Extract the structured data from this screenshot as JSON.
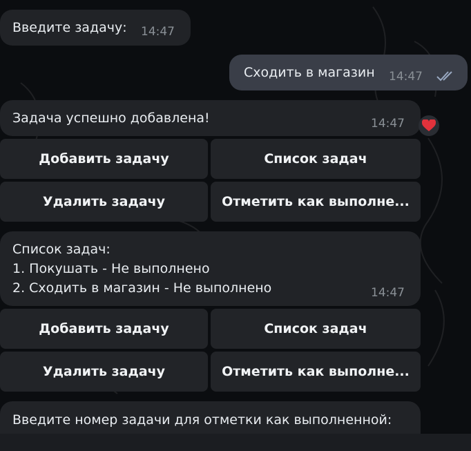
{
  "messages": {
    "prompt_task": {
      "text": "Введите задачу:",
      "time": "14:47"
    },
    "user_task": {
      "text": "Сходить в магазин",
      "time": "14:47"
    },
    "added": {
      "text": "Задача успешно добавлена!",
      "time": "14:47",
      "reaction": "heart-icon"
    },
    "list": {
      "text": "Список задач:\n1. Покушать - Не выполнено\n2. Сходить в магазин - Не выполнено",
      "time": "14:47"
    },
    "prompt_mark": {
      "text": "Введите номер задачи для отметки как выполненной:"
    }
  },
  "keyboard": {
    "add": "Добавить задачу",
    "list": "Список задач",
    "delete": "Удалить задачу",
    "mark_done": "Отметить как выполне..."
  },
  "colors": {
    "background": "#0b0d10",
    "incoming_bubble": "#212327",
    "outgoing_bubble": "#3a3e48",
    "reaction_heart": "#e0323c",
    "read_checks": "#9aa9c2"
  }
}
